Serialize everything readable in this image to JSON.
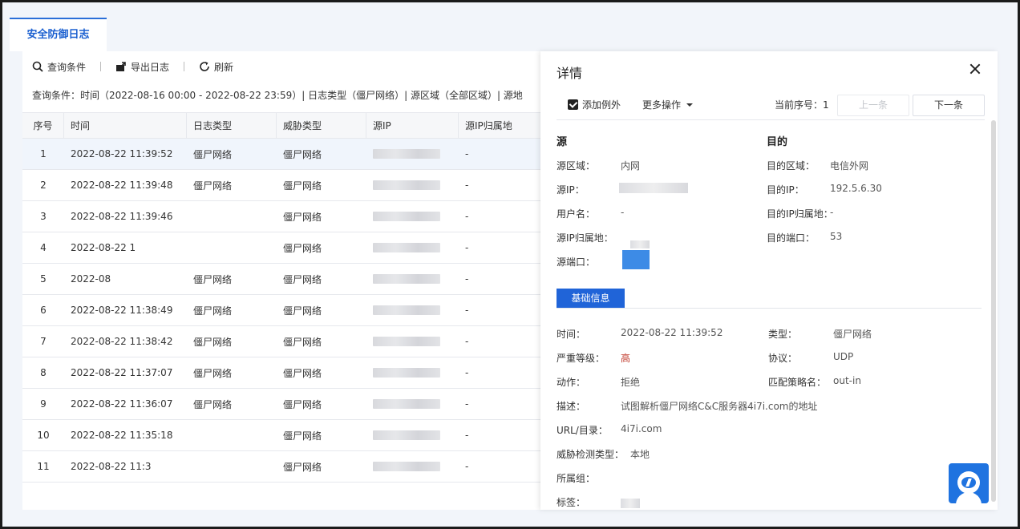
{
  "tab": {
    "label": "安全防御日志"
  },
  "toolbar": {
    "query": "查询条件",
    "export": "导出日志",
    "refresh": "刷新"
  },
  "query_summary": "查询条件：时间（2022-08-16 00:00 - 2022-08-22 23:59）| 日志类型（僵尸网络）| 源区域（全部区域）| 源地",
  "table": {
    "headers": [
      "序号",
      "时间",
      "日志类型",
      "威胁类型",
      "源IP",
      "源IP归属地"
    ],
    "rows": [
      {
        "no": "1",
        "time": "2022-08-22 11:39:52",
        "log_type": "僵尸网络",
        "threat": "僵尸网络",
        "loc": "-"
      },
      {
        "no": "2",
        "time": "2022-08-22 11:39:48",
        "log_type": "僵尸网络",
        "threat": "僵尸网络",
        "loc": "-"
      },
      {
        "no": "3",
        "time": "2022-08-22 11:39:46",
        "log_type": "",
        "threat": "僵尸网络",
        "loc": "-"
      },
      {
        "no": "4",
        "time": "2022-08-22 1",
        "log_type": "",
        "threat": "僵尸网络",
        "loc": "-"
      },
      {
        "no": "5",
        "time": "2022-08",
        "log_type": "僵尸网络",
        "threat": "僵尸网络",
        "loc": "-"
      },
      {
        "no": "6",
        "time": "2022-08-22 11:38:49",
        "log_type": "僵尸网络",
        "threat": "僵尸网络",
        "loc": "-"
      },
      {
        "no": "7",
        "time": "2022-08-22 11:38:42",
        "log_type": "僵尸网络",
        "threat": "僵尸网络",
        "loc": "-"
      },
      {
        "no": "8",
        "time": "2022-08-22 11:37:07",
        "log_type": "僵尸网络",
        "threat": "僵尸网络",
        "loc": "-"
      },
      {
        "no": "9",
        "time": "2022-08-22 11:36:07",
        "log_type": "僵尸网络",
        "threat": "僵尸网络",
        "loc": "-"
      },
      {
        "no": "10",
        "time": "2022-08-22 11:35:18",
        "log_type": "",
        "threat": "僵尸网络",
        "loc": "-"
      },
      {
        "no": "11",
        "time": "2022-08-22 11:3",
        "log_type": "",
        "threat": "僵尸网络",
        "loc": "-"
      }
    ]
  },
  "drawer": {
    "title": "详情",
    "add_exception": "添加例外",
    "more_actions": "更多操作",
    "current_index_label": "当前序号：1",
    "prev": "上一条",
    "next": "下一条",
    "source": {
      "heading": "源",
      "zone_label": "源区域：",
      "zone": "内网",
      "ip_label": "源IP：",
      "user_label": "用户名：",
      "user": "-",
      "loc_label": "源IP归属地：",
      "port_label": "源端口："
    },
    "dest": {
      "heading": "目的",
      "zone_label": "目的区域：",
      "zone": "电信外网",
      "ip_label": "目的IP：",
      "ip": "192.5.6.30",
      "loc_label": "目的IP归属地：",
      "loc": "-",
      "port_label": "目的端口：",
      "port": "53"
    },
    "basic": {
      "tab": "基础信息",
      "time_label": "时间：",
      "time": "2022-08-22 11:39:52",
      "type_label": "类型：",
      "type": "僵尸网络",
      "severity_label": "严重等级：",
      "severity": "高",
      "protocol_label": "协议：",
      "protocol": "UDP",
      "action_label": "动作：",
      "action": "拒绝",
      "policy_label": "匹配策略名：",
      "policy": "out-in",
      "desc_label": "描述：",
      "desc": "试图解析僵尸网络C&C服务器4i7i.com的地址",
      "url_label": "URL/目录：",
      "url": "4i7i.com",
      "detect_label": "威胁检测类型：",
      "detect": "本地",
      "group_label": "所属组：",
      "tag_label": "标签："
    }
  },
  "colors": {
    "accent": "#2064d8",
    "severity_high": "#c0392b"
  }
}
